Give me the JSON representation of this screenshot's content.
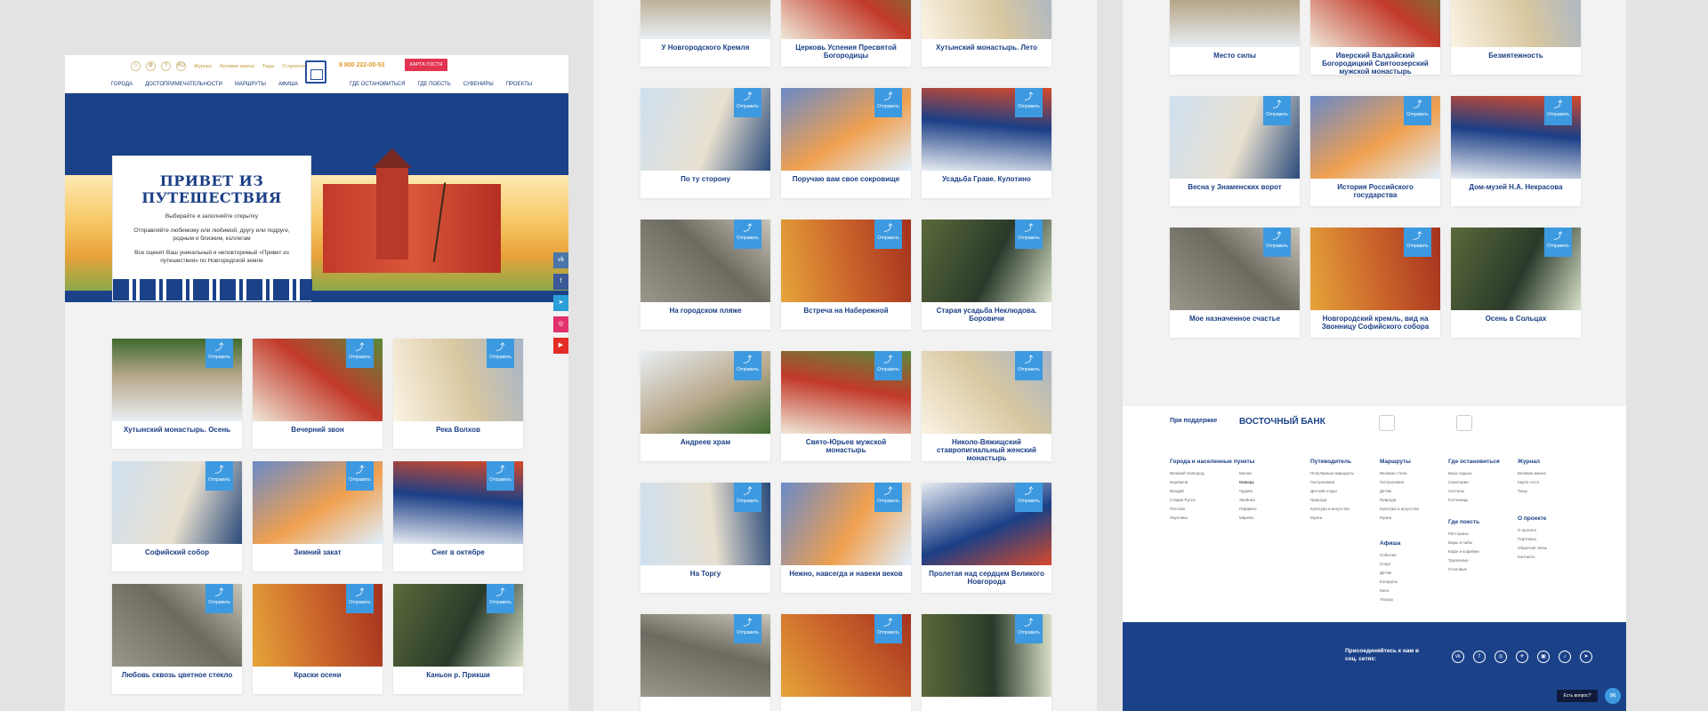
{
  "header": {
    "icons": [
      "☺",
      "⚙",
      "?",
      "RU"
    ],
    "top_links": [
      "Журнал",
      "Великие имена",
      "Тицы",
      "О проекте"
    ],
    "phone": "8 800 222-00-53",
    "guest_card": "КАРТА ГОСТЯ",
    "nav": [
      "ГОРОДА",
      "ДОСТОПРИМЕЧАТЕЛЬНОСТИ",
      "МАРШРУТЫ",
      "АФИША",
      "ГДЕ ОСТАНОВИТЬСЯ",
      "ГДЕ ПОЕСТЬ",
      "СУВЕНИРЫ",
      "ПРОЕКТЫ"
    ]
  },
  "hero": {
    "title": "ПРИВЕТ ИЗ ПУТЕШЕСТВИЯ",
    "line1": "Выбирайте и заполняйте открытку",
    "line2": "Отправляйте любимому или любимой, другу или подруге, родным и близким, коллегам",
    "line3": "Все оценят Ваш уникальный и неповторимый «Привет из путешествия» по Новгородской земле"
  },
  "social_side": [
    "vk",
    "f",
    "➤",
    "◎",
    "▶"
  ],
  "share_label": "Отправить",
  "col1_cards": [
    "Хутынский монастырь. Осень",
    "Вечерний звон",
    "Река Волхов",
    "Софийский собор",
    "Зимний закат",
    "Снег в октябре",
    "Любовь сквозь цветное стекло",
    "Краски осени",
    "Каньон р. Прикши"
  ],
  "col2_cards": [
    "У Новгородского Кремля",
    "Церковь Успения Пресвятой Богородицы",
    "Хутынский монастырь. Лето",
    "По ту сторону",
    "Поручаю вам свое сокровище",
    "Усадьба Граве. Кулотино",
    "На городском пляже",
    "Встреча на Набережной",
    "Старая усадьба Неклюдова. Боровичи",
    "Андреев храм",
    "Свято-Юрьев мужской монастырь",
    "Николо-Вяжищский ставропигиальный женский монастырь",
    "На Торгу",
    "Нежно, навсегда и навеки веков",
    "Пролетая над сердцем Великого Новгорода",
    "",
    "",
    ""
  ],
  "col3_cards": [
    "Место силы",
    "Иверский Валдайский Богородицкий Святоозерский мужской монастырь",
    "Безмятежность",
    "Весна у Знаменских ворот",
    "История Российского государства",
    "Дом-музей Н.А. Некрасова",
    "Мое назначенное счастье",
    "Новгородский кремль, вид на Звонницу Софийского собора",
    "Осень в Сольцах"
  ],
  "footer": {
    "partners_label": "При поддержке",
    "bank": "ВОСТОЧНЫЙ БАНК",
    "cols": [
      {
        "title": "Города и населенные пункты",
        "items": [
          "Великий Новгород",
          "Боровичи",
          "Валдай",
          "Старая Русса",
          "Пестово",
          "Окуловка",
          "Малая Вишера",
          "Сольцы",
          "Чудово",
          "Хвойная",
          "Парфино",
          "Марево"
        ]
      },
      {
        "title": "Путеводитель",
        "items": [
          "Популярные маршруты",
          "Гастрономия",
          "Детский отдых",
          "Природа",
          "Культура и искусство",
          "Музеи"
        ]
      },
      {
        "title": "Маршруты",
        "items": [
          "Великая стена",
          "Гастрономия",
          "Детям",
          "Природа",
          "Культура и искусство",
          "Музеи"
        ]
      },
      {
        "title": "Афиша",
        "items": [
          "События",
          "Спорт",
          "Детям",
          "Концерты",
          "Кино",
          "Театры"
        ]
      },
      {
        "title": "Где остановиться",
        "items": [
          "База отдыха",
          "Санатории",
          "Хостелы",
          "Гостиницы"
        ]
      },
      {
        "title": "Где поесть",
        "items": [
          "Рестораны",
          "Бары и пабы",
          "Кафе и кофейни",
          "Трапезные",
          "Столовые"
        ]
      },
      {
        "title": "Журнал",
        "items": [
          "Великие имена",
          "Карта гостя",
          "Тицы"
        ]
      },
      {
        "title": "О проекте",
        "items": [
          "О проекте",
          "Партнеры",
          "Обратная связь",
          "Контакты"
        ]
      }
    ],
    "join": "Присоединяйтесь к нам в соц. сетях:",
    "socials": [
      "vk",
      "f",
      "◎",
      "✈",
      "▣",
      "♪",
      "➤"
    ],
    "ask": "Есть вопрос?"
  }
}
